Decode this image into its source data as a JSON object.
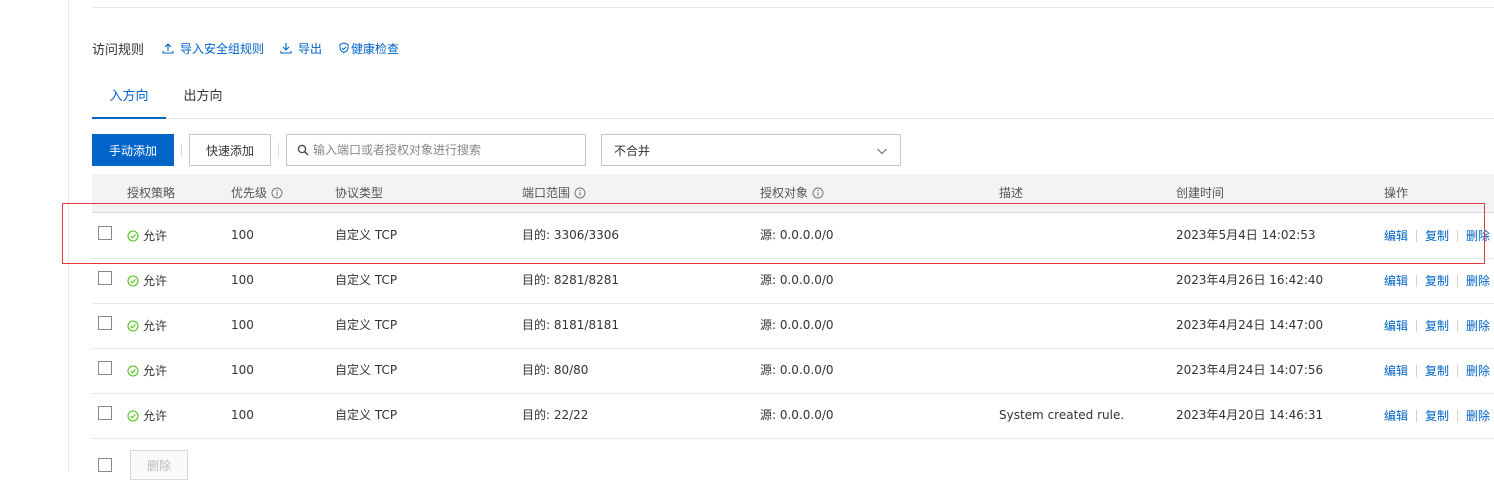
{
  "section": {
    "title": "访问规则",
    "links": [
      "导入安全组规则",
      "导出",
      "健康检查"
    ]
  },
  "tabs": [
    "入方向",
    "出方向"
  ],
  "toolbar": {
    "manual_add": "手动添加",
    "quick_add": "快速添加",
    "search_placeholder": "输入端口或者授权对象进行搜索",
    "merge_select": "不合并"
  },
  "table": {
    "columns": [
      "授权策略",
      "优先级",
      "协议类型",
      "端口范围",
      "授权对象",
      "描述",
      "创建时间",
      "操作"
    ],
    "rows": [
      {
        "policy": "允许",
        "priority": "100",
        "protocol": "自定义 TCP",
        "port": "目的: 3306/3306",
        "object": "源: 0.0.0.0/0",
        "desc": "",
        "created": "2023年5月4日 14:02:53"
      },
      {
        "policy": "允许",
        "priority": "100",
        "protocol": "自定义 TCP",
        "port": "目的: 8281/8281",
        "object": "源: 0.0.0.0/0",
        "desc": "",
        "created": "2023年4月26日 16:42:40"
      },
      {
        "policy": "允许",
        "priority": "100",
        "protocol": "自定义 TCP",
        "port": "目的: 8181/8181",
        "object": "源: 0.0.0.0/0",
        "desc": "",
        "created": "2023年4月24日 14:47:00"
      },
      {
        "policy": "允许",
        "priority": "100",
        "protocol": "自定义 TCP",
        "port": "目的: 80/80",
        "object": "源: 0.0.0.0/0",
        "desc": "",
        "created": "2023年4月24日 14:07:56"
      },
      {
        "policy": "允许",
        "priority": "100",
        "protocol": "自定义 TCP",
        "port": "目的: 22/22",
        "object": "源: 0.0.0.0/0",
        "desc": "System created rule.",
        "created": "2023年4月20日 14:46:31"
      }
    ],
    "actions": [
      "编辑",
      "复制",
      "删除"
    ]
  },
  "footer": {
    "delete_label": "删除"
  },
  "colors": {
    "accent": "#0064c8",
    "success": "#52c41a",
    "highlight": "#e0393e"
  }
}
